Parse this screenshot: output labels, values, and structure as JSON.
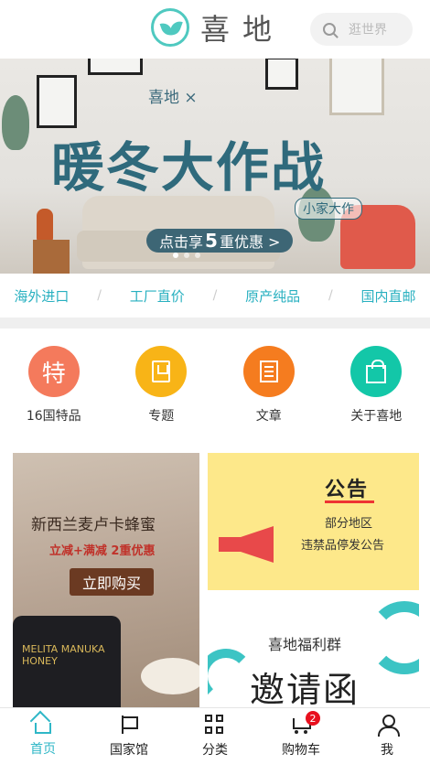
{
  "header": {
    "logo_text": "喜地",
    "search_placeholder": "逛世界"
  },
  "banner": {
    "brand_line": "喜地 × ",
    "title": "暖冬大作战",
    "tag": "小家大作",
    "cta_prefix": "点击享",
    "cta_number": "5",
    "cta_suffix": "重优惠 >"
  },
  "tags": [
    "海外进口",
    "工厂直价",
    "原产纯品",
    "国内直邮"
  ],
  "tag_separator": "/",
  "categories": [
    {
      "label": "16国特品",
      "glyph": "特",
      "color": "#f47a5c"
    },
    {
      "label": "专题",
      "icon": "book-icon",
      "color": "#f8b417"
    },
    {
      "label": "文章",
      "icon": "document-icon",
      "color": "#f57c1f"
    },
    {
      "label": "关于喜地",
      "icon": "shopping-bag-icon",
      "color": "#13c7a8"
    }
  ],
  "promo_honey": {
    "title": "新西兰麦卢卡蜂蜜",
    "subtitle": "立减+满减 2重优惠",
    "button": "立即购买",
    "jar_label": "MELITA MANUKA HONEY"
  },
  "promo_notice": {
    "title": "公告",
    "line1": "部分地区",
    "line2": "违禁品停发公告"
  },
  "promo_invite": {
    "subtitle": "喜地福利群",
    "title": "邀请函"
  },
  "tabbar": {
    "items": [
      {
        "label": "首页",
        "icon": "home-icon",
        "active": true
      },
      {
        "label": "国家馆",
        "icon": "flag-icon",
        "active": false
      },
      {
        "label": "分类",
        "icon": "grid-icon",
        "active": false
      },
      {
        "label": "购物车",
        "icon": "cart-icon",
        "active": false,
        "badge": "2"
      },
      {
        "label": "我",
        "icon": "user-icon",
        "active": false
      }
    ]
  },
  "colors": {
    "accent": "#2fb7c7",
    "badge": "#e8101e"
  }
}
